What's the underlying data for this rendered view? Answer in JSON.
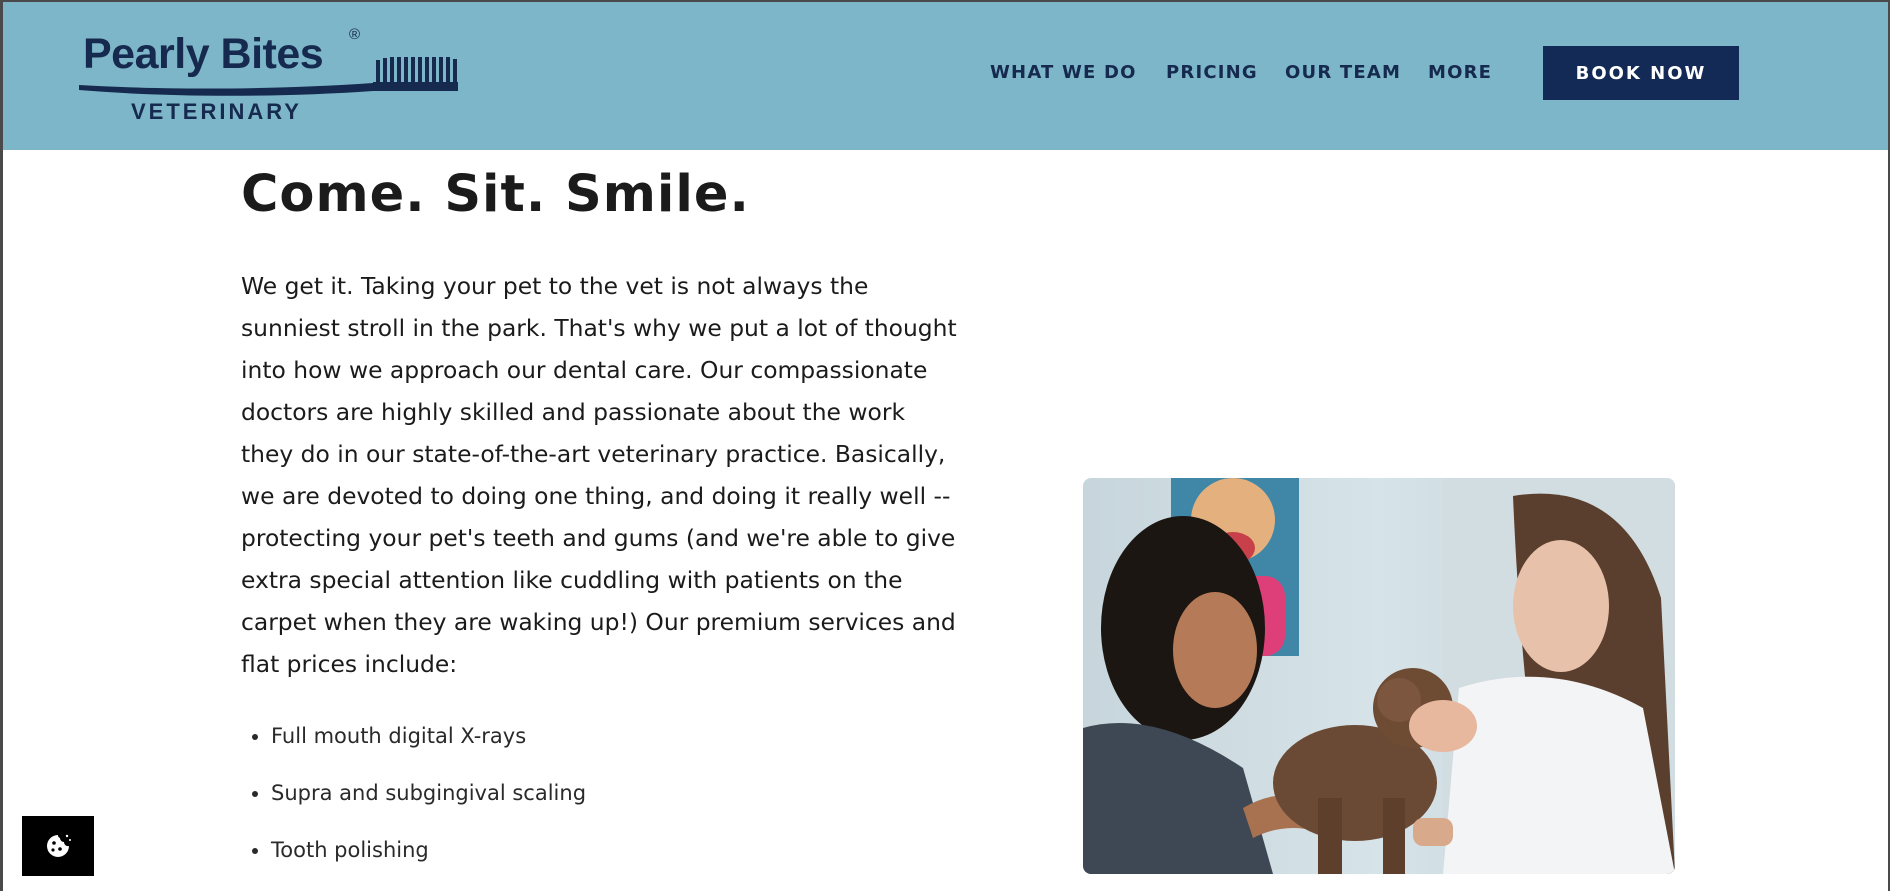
{
  "brand": {
    "name": "Pearly Bites",
    "registered_mark": "®",
    "subtitle": "VETERINARY"
  },
  "nav": {
    "items": [
      "WHAT WE DO",
      "PRICING",
      "OUR TEAM",
      "MORE"
    ],
    "cta_label": "BOOK NOW"
  },
  "main": {
    "headline": "Come. Sit. Smile.",
    "intro": "We get it. Taking your pet to the vet is not always the sunniest stroll in the park. That's why we put a lot of thought into how we approach our dental care. Our compassionate doctors are highly skilled and passionate about the work they do in our state-of-the-art veterinary practice. Basically, we are devoted to doing one thing, and doing it really well -- protecting your pet's teeth and gums (and we're able to give extra special attention like cuddling with patients on the carpet when they are waking up!) Our premium services and flat prices include:",
    "services": [
      "Full mouth digital X-rays",
      "Supra and subgingival scaling",
      "Tooth polishing"
    ]
  },
  "icons": {
    "cookie": "cookie-icon",
    "logo_brush": "toothbrush-icon"
  },
  "colors": {
    "header_bg": "#7db6c8",
    "brand_navy": "#16294f",
    "button_bg": "#142a56",
    "text": "#1b1b1b"
  }
}
